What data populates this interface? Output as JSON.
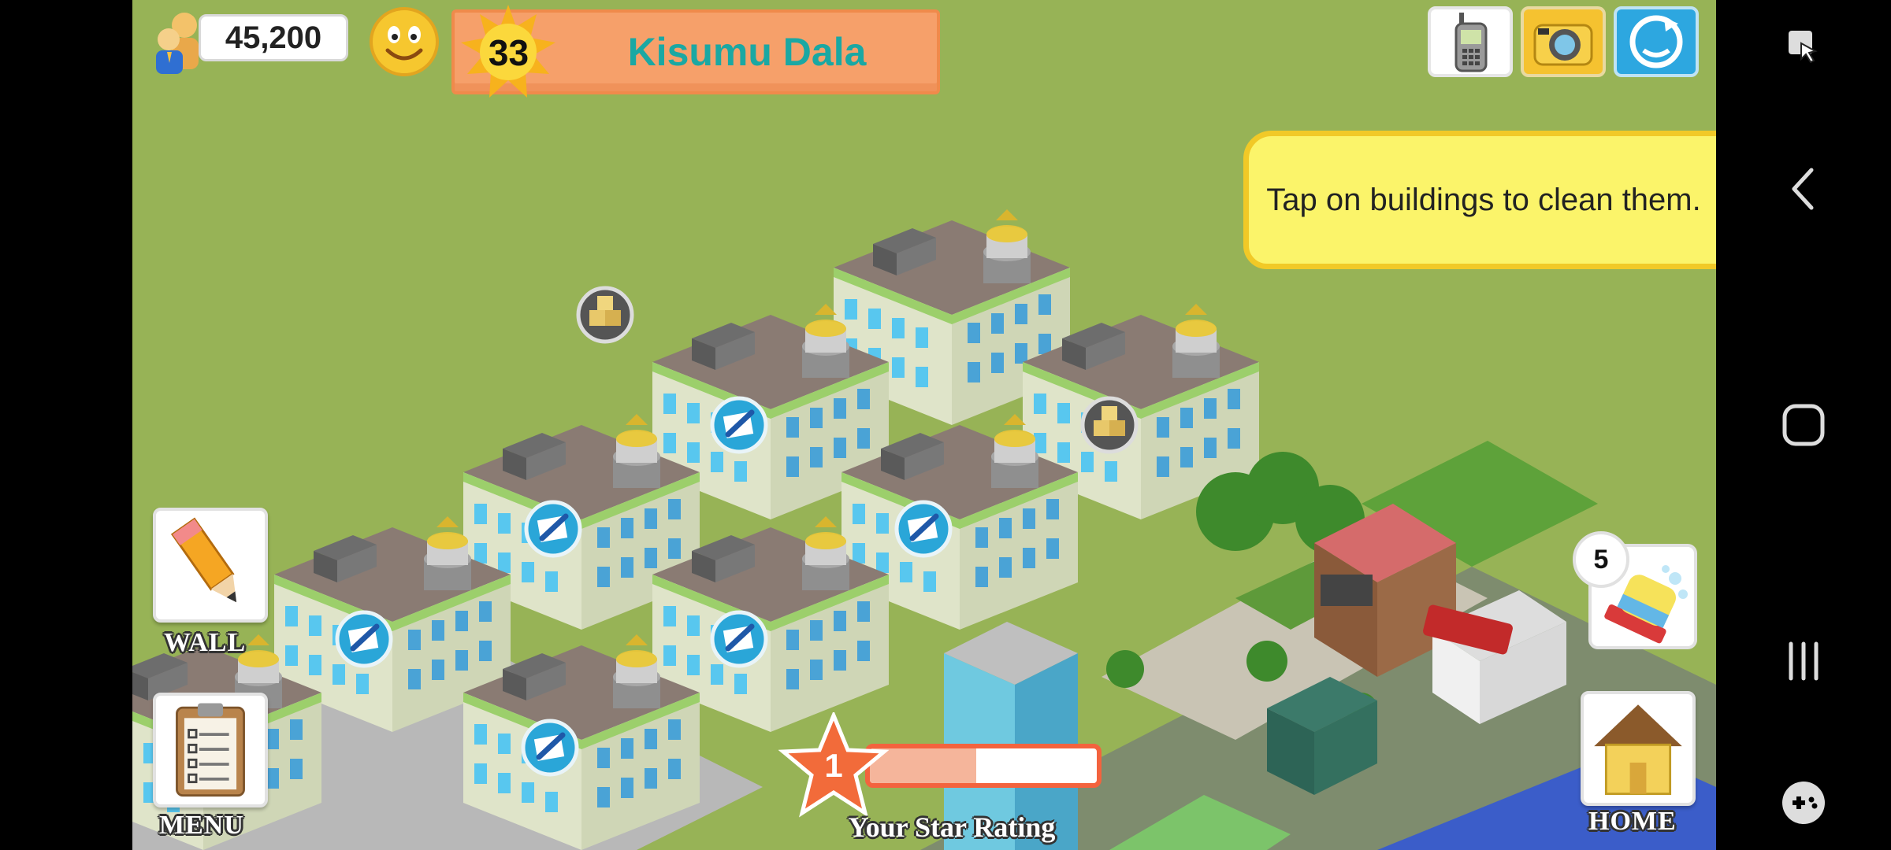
{
  "hud": {
    "population": "45,200",
    "mood": "happy",
    "level": "33",
    "city_name": "Kisumu Dala",
    "buttons": {
      "phone": "phone-icon",
      "camera": "camera-icon",
      "share": "share-icon"
    }
  },
  "tip": {
    "text": "Tap on buildings to clean them."
  },
  "side_buttons": {
    "wall_label": "WALL",
    "menu_label": "MENU",
    "home_label": "HOME"
  },
  "clean_tool": {
    "count": "5"
  },
  "star_rating": {
    "stars": "1",
    "label": "Your Star Rating",
    "progress": 0.47
  },
  "colors": {
    "ground": "#97b356",
    "banner": "#f6a06a",
    "city_name": "#1aa8a3",
    "tip_bg": "#fbf46a",
    "rating_border": "#f3633e"
  },
  "system_nav": {
    "icons": [
      "screen-capture-icon",
      "back-icon",
      "home-icon",
      "recents-icon",
      "game-tools-icon"
    ]
  }
}
